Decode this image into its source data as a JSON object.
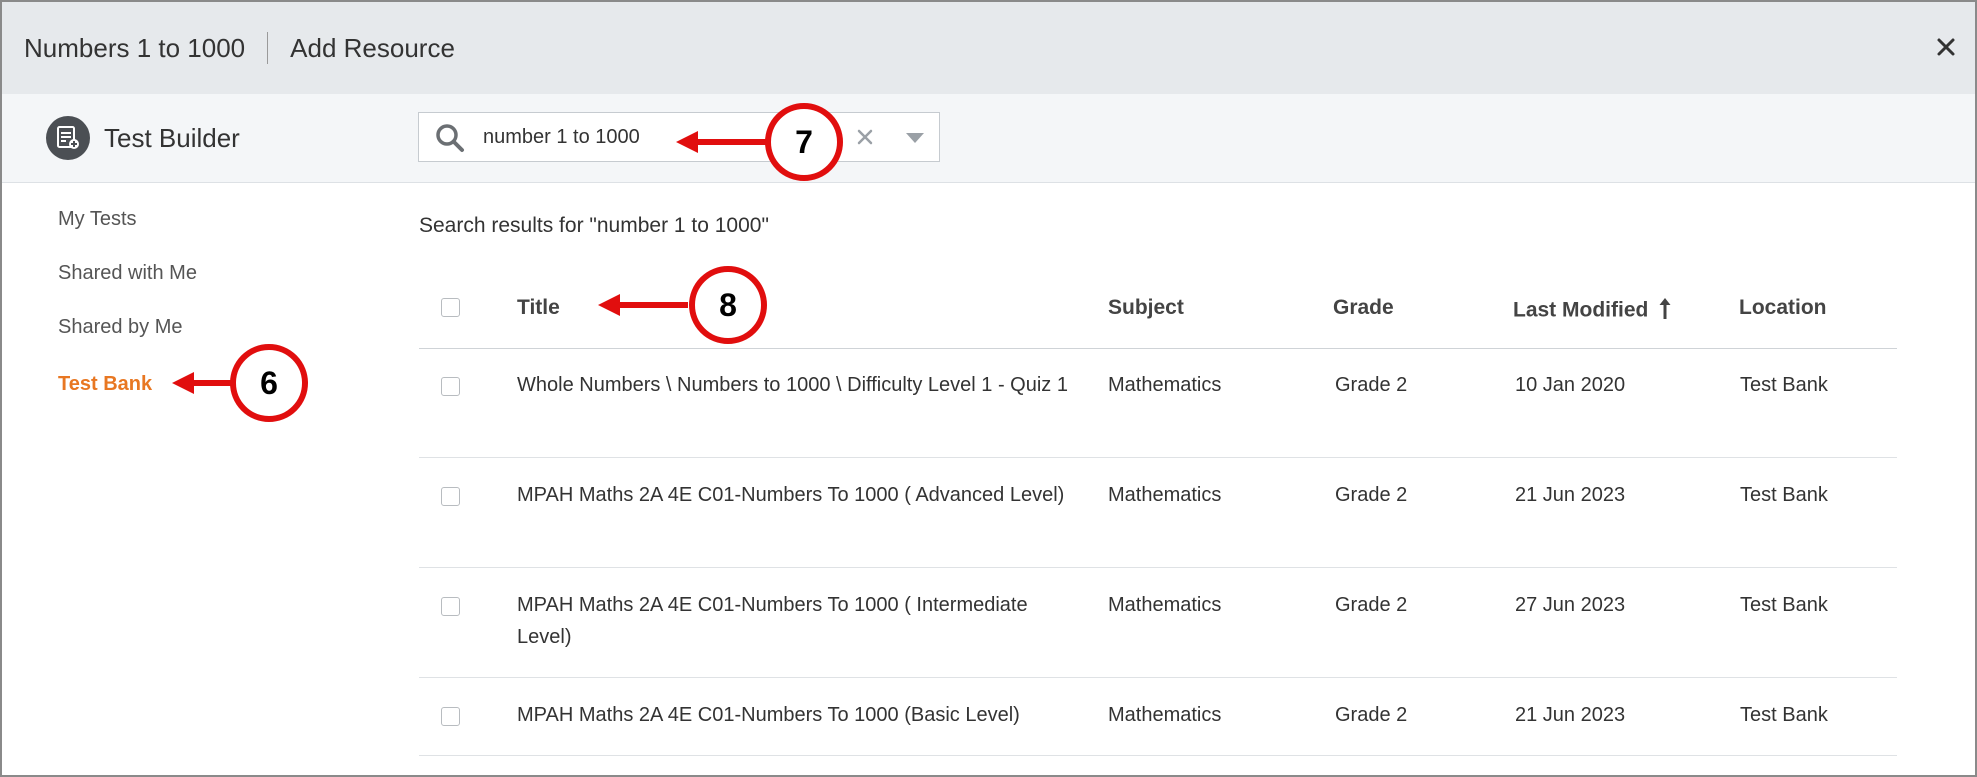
{
  "window": {
    "resource_title": "Numbers 1 to 1000",
    "dialog_title": "Add Resource",
    "close_icon": "close-icon"
  },
  "toolbar": {
    "app_name": "Test Builder",
    "app_icon": "test-builder-icon",
    "search": {
      "value": "number 1 to 1000",
      "placeholder": "",
      "icons": [
        "search-icon",
        "clear-icon",
        "dropdown-caret-icon"
      ]
    }
  },
  "sidebar": {
    "items": [
      {
        "label": "My Tests",
        "active": false
      },
      {
        "label": "Shared with Me",
        "active": false
      },
      {
        "label": "Shared by Me",
        "active": false
      },
      {
        "label": "Test Bank",
        "active": true
      }
    ]
  },
  "results": {
    "heading": "Search results for \"number 1 to 1000\"",
    "columns": {
      "title": "Title",
      "subject": "Subject",
      "grade": "Grade",
      "last_modified": "Last Modified",
      "location": "Location"
    },
    "sort": {
      "column": "last_modified",
      "direction": "ascending",
      "icon": "sort-arrow-up-icon"
    },
    "rows": [
      {
        "title": "Whole Numbers \\ Numbers to 1000 \\ Difficulty Level 1 - Quiz 1",
        "subject": "Mathematics",
        "grade": "Grade 2",
        "last_modified": "10 Jan 2020",
        "location": "Test Bank"
      },
      {
        "title": "MPAH Maths 2A 4E C01-Numbers To 1000 ( Advanced Level)",
        "subject": "Mathematics",
        "grade": "Grade 2",
        "last_modified": "21 Jun 2023",
        "location": "Test Bank"
      },
      {
        "title": "MPAH Maths 2A 4E C01-Numbers To 1000 ( Intermediate Level)",
        "subject": "Mathematics",
        "grade": "Grade 2",
        "last_modified": "27 Jun 2023",
        "location": "Test Bank"
      },
      {
        "title": "MPAH Maths 2A 4E C01-Numbers To 1000 (Basic Level)",
        "subject": "Mathematics",
        "grade": "Grade 2",
        "last_modified": "21 Jun 2023",
        "location": "Test Bank"
      }
    ]
  },
  "callouts": [
    {
      "number": "6",
      "target": "Test Bank"
    },
    {
      "number": "7",
      "target": "search field"
    },
    {
      "number": "8",
      "target": "Title column"
    }
  ],
  "colors": {
    "active_nav": "#e87722",
    "callout": "#e10e0e",
    "titlebar_bg": "#e6e9ec"
  }
}
